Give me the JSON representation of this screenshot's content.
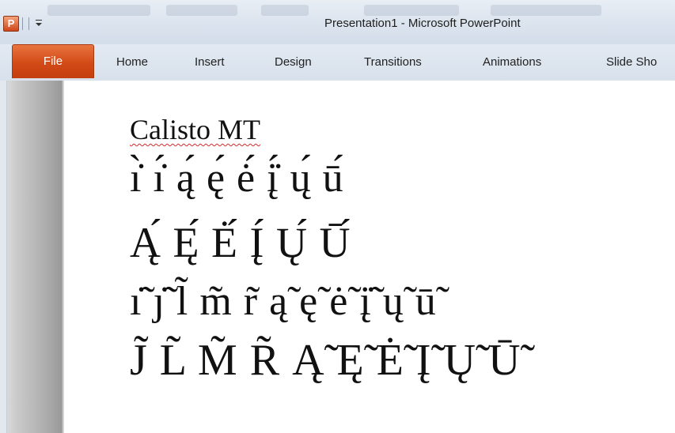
{
  "app": {
    "logo_letter": "P",
    "window_title": "Presentation1 - Microsoft PowerPoint"
  },
  "ribbon": {
    "file_label": "File",
    "tabs": [
      "Home",
      "Insert",
      "Design",
      "Transitions",
      "Animations",
      "Slide Sho"
    ]
  },
  "slide": {
    "font_name": "Calisto MT",
    "lines": [
      "ı̇̀ ı̇́ ą́ ę́ ė́ į̇́ ų́ ū́",
      "Ą́ Ę́ Ė́ Į́ Ų́ Ū́",
      "ı̇̃ ȷ̇̃ l̃ m̃ r̃ ą̃ ę̃ ė̃ į̇̃ ų̃ ū̃",
      "J̃ L̃ M̃ R̃ Ą̃ Ę̃ Ė̃ Į̃ Ų̃ Ū̃"
    ]
  },
  "colors": {
    "file_tab": "#d24a16",
    "spellcheck": "#d52a2a"
  }
}
